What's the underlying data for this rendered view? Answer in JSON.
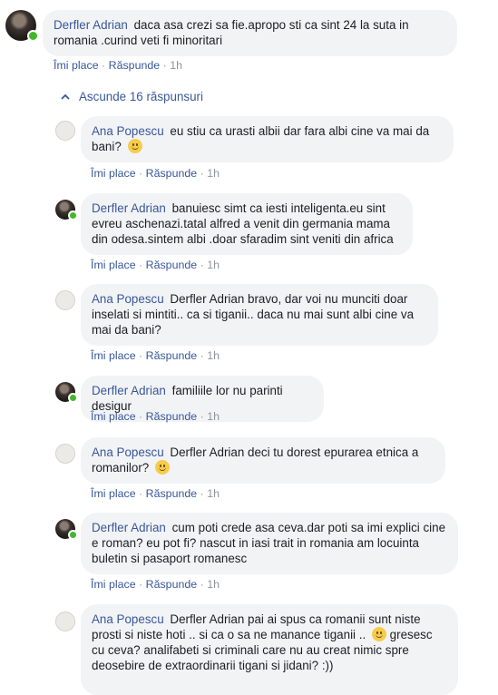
{
  "thread": {
    "toggle_label": "Ascunde 16 răspunsuri"
  },
  "actions": {
    "like": "Îmi place",
    "reply": "Răspunde",
    "separator": "·"
  },
  "comments": [
    {
      "author": "Derfler Adrian",
      "text": "daca asa crezi sa fie.apropo sti ca sint 24 la suta in romania .curind veti fi minoritari",
      "time": "1h"
    },
    {
      "author": "Ana Popescu",
      "text": "eu stiu ca urasti albii dar fara albi cine va mai da bani?",
      "time": "1h"
    },
    {
      "author": "Derfler Adrian",
      "text": "banuiesc simt ca iesti inteligenta.eu sint evreu aschenazi.tatal alfred a venit din germania mama din odesa.sintem albi .doar sfaradim sint veniti din africa",
      "time": "1h"
    },
    {
      "author": "Ana Popescu",
      "text": "Derfler Adrian bravo, dar voi nu munciti doar inselati si mintiti.. ca si tiganii.. daca nu mai sunt albi cine va mai da bani?",
      "time": "1h"
    },
    {
      "author": "Derfler Adrian",
      "text": "familiile lor nu parinti desigur",
      "time": "1h"
    },
    {
      "author": "Ana Popescu",
      "text": "Derfler Adrian deci tu dorest epurarea etnica a romanilor?",
      "time": "1h"
    },
    {
      "author": "Derfler Adrian",
      "text": "cum poti crede asa ceva.dar poti sa imi explici cine e roman? eu pot fi? nascut in iasi trait in romania am locuinta buletin si pasaport romanesc",
      "time": "1h"
    },
    {
      "author": "Ana Popescu",
      "text_a": "Derfler Adrian pai ai spus ca romanii sunt niste prosti si niste hoti .. si ca o sa ne manance tiganii ..",
      "text_b": "gresesc cu ceva? analifabeti si criminali care nu au creat nimic spre deosebire de extraordinarii tigani si jidani? :))"
    }
  ]
}
